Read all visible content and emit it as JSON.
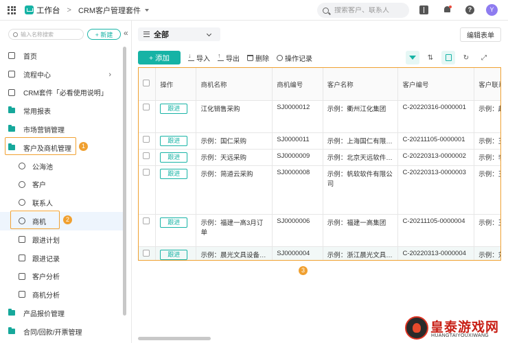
{
  "topbar": {
    "app_name": "工作台",
    "breadcrumb_sep": ">",
    "crumb": "CRM客户管理套件",
    "search_placeholder": "搜索客户、联系人",
    "avatar_letter": "Y"
  },
  "sidebar": {
    "search_placeholder": "输入名称搜索",
    "new_label": "+ 新建",
    "collapse": "«",
    "items": [
      {
        "label": "首页",
        "icon": "home-icon"
      },
      {
        "label": "流程中心",
        "icon": "flow-icon"
      },
      {
        "label": "CRM套件「必看使用说明」",
        "icon": "doc-icon"
      },
      {
        "label": "常用报表",
        "icon": "folder-icon"
      },
      {
        "label": "市场营销管理",
        "icon": "folder-icon"
      },
      {
        "label": "客户及商机管理",
        "icon": "folder-icon"
      },
      {
        "label": "公海池",
        "icon": "pool-icon"
      },
      {
        "label": "客户",
        "icon": "person-icon"
      },
      {
        "label": "联系人",
        "icon": "person-icon"
      },
      {
        "label": "商机",
        "icon": "opportunity-icon"
      },
      {
        "label": "跟进计划",
        "icon": "calendar-icon"
      },
      {
        "label": "跟进记录",
        "icon": "record-icon"
      },
      {
        "label": "客户分析",
        "icon": "chart-icon"
      },
      {
        "label": "商机分析",
        "icon": "chart-icon"
      },
      {
        "label": "产品报价管理",
        "icon": "folder-icon"
      },
      {
        "label": "合同/回款/开票管理",
        "icon": "folder-icon"
      }
    ],
    "badge1": "1",
    "badge2": "2"
  },
  "main": {
    "view_label": "全部",
    "edit_form": "编辑表单",
    "toolbar": {
      "add": "+ 添加",
      "import": "导入",
      "export": "导出",
      "delete": "删除",
      "log": "操作记录"
    },
    "badge3": "3",
    "table": {
      "headers": [
        "操作",
        "商机名称",
        "商机编号",
        "客户名称",
        "客户编号",
        "客户联系人"
      ],
      "follow_label": "跟进",
      "rows": [
        [
          "江化销售采购",
          "SJ0000012",
          "示例：衢州江化集团",
          "C-20220316-0000001",
          "示例：赵仁民"
        ],
        [
          "示例：国仁采购",
          "SJ0000011",
          "示例：上海国仁有限…",
          "C-20211105-0000001",
          "示例：王倩"
        ],
        [
          "示例：天远采购",
          "SJ0000009",
          "示例：北京天远软件…",
          "C-20220313-0000002",
          "示例：李清海"
        ],
        [
          "示例：简道云采购",
          "SJ0000008",
          "示例：帆软软件有限公司",
          "C-20220313-0000003",
          "示例：王立"
        ],
        [
          "示例：福建一高3月订单",
          "SJ0000006",
          "示例：福建一高集团",
          "C-20211105-0000004",
          "示例：王宁"
        ],
        [
          "示例：晨光文具设备…",
          "SJ0000004",
          "示例：浙江晨光文具…",
          "C-20220313-0000004",
          "示例：刘晨"
        ]
      ]
    }
  },
  "watermark": {
    "title": "皇泰游戏网",
    "sub": "HUANGTAIYOUXIWANG"
  },
  "colors": {
    "accent": "#16b3a5",
    "highlight": "#f0a030"
  }
}
